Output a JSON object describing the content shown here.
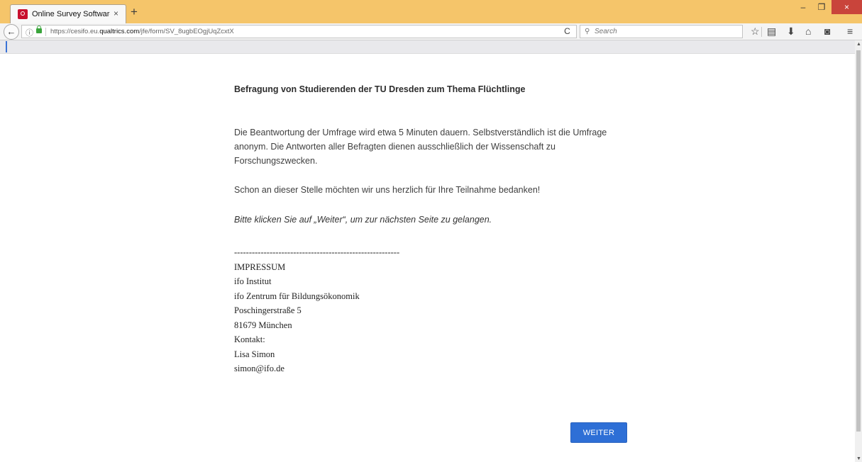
{
  "browser": {
    "tab_title": "Online Survey Software | ...",
    "tab_close": "×",
    "new_tab": "+",
    "window_controls": {
      "minimize": "–",
      "maximize": "❐",
      "close": "×"
    },
    "back": "←",
    "info": "ⓘ",
    "url_prefix": "https://cesifo.eu.",
    "url_domain": "qualtrics.com",
    "url_path": "/jfe/form/SV_8ugbEOgjUqZcxtX",
    "reload": "C",
    "search_placeholder": "Search",
    "search_glyph": "⚲",
    "toolbar_icons": {
      "bookmark": "☆",
      "reading_list": "▤",
      "downloads": "⬇",
      "home": "⌂",
      "pocket": "◙",
      "menu": "≡"
    },
    "scroll_up": "▲",
    "scroll_down": "▼"
  },
  "survey": {
    "title": "Befragung von Studierenden der TU Dresden zum Thema Flüchtlinge",
    "intro": "Die Beantwortung der Umfrage wird etwa 5 Minuten dauern. Selbstverständlich ist die Umfrage anonym.  Die Antworten aller Befragten dienen ausschließlich der Wissenschaft zu Forschungszwecken.",
    "thanks": "Schon an dieser Stelle möchten wir uns herzlich für Ihre Teilnahme bedanken!",
    "next_hint": "Bitte klicken Sie auf „Weiter“, um zur nächsten Seite zu gelangen.",
    "divider": "--------------------------------------------------------",
    "impressum": {
      "heading": "IMPRESSUM",
      "line1": "ifo Institut",
      "line2": "ifo Zentrum für Bildungsökonomik",
      "street": "Poschingerstraße 5",
      "city": "81679 München",
      "contact_label": "Kontakt:",
      "contact_name": "Lisa Simon",
      "contact_email": "simon@ifo.de"
    },
    "next_button": "WEITER"
  },
  "colors": {
    "titlebar": "#f5c56a",
    "button": "#2e6fd6",
    "close": "#c9443b"
  }
}
